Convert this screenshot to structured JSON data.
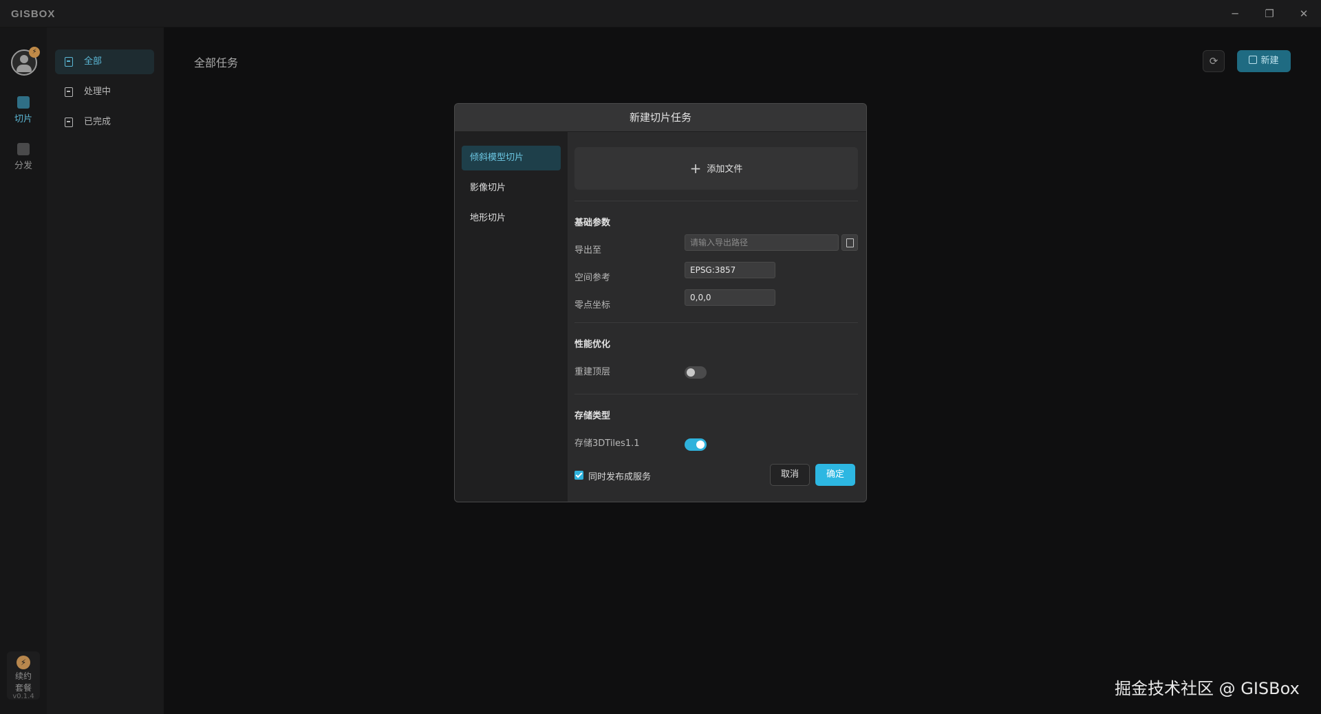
{
  "app": {
    "logo": "GISBOX"
  },
  "window_controls": {
    "minimize": "─",
    "restore": "❐",
    "close": "✕"
  },
  "rail": {
    "avatar_badge": "⚡",
    "items": [
      {
        "label": "切片",
        "icon": "slice-icon"
      },
      {
        "label": "分发",
        "icon": "distribute-icon"
      }
    ],
    "renew": {
      "icon": "⚡",
      "label": "续约套餐"
    },
    "version": "v0.1.4"
  },
  "filters": {
    "items": [
      {
        "label": "全部"
      },
      {
        "label": "处理中"
      },
      {
        "label": "已完成"
      }
    ]
  },
  "main": {
    "title": "全部任务",
    "refresh_icon": "⟳",
    "new_button": "新建"
  },
  "modal": {
    "title": "新建切片任务",
    "tabs": [
      {
        "label": "倾斜模型切片"
      },
      {
        "label": "影像切片"
      },
      {
        "label": "地形切片"
      }
    ],
    "add_file": {
      "icon": "+",
      "label": "添加文件"
    },
    "basic": {
      "title": "基础参数",
      "export_label": "导出至",
      "export_placeholder": "请输入导出路径",
      "export_value": "",
      "crs_label": "空间参考",
      "crs_value": "EPSG:3857",
      "origin_label": "零点坐标",
      "origin_value": "0,0,0"
    },
    "perf": {
      "title": "性能优化",
      "rebuild_top_label": "重建顶层",
      "rebuild_top": false
    },
    "storage": {
      "title": "存储类型",
      "tiles_label": "存储3DTiles1.1",
      "tiles": true
    },
    "publish": {
      "label": "同时发布成服务",
      "checked": true
    },
    "cancel_label": "取消",
    "ok_label": "确定"
  },
  "watermark": "掘金技术社区 @ GISBox",
  "colors": {
    "accent": "#2db7e2",
    "active_text": "#5cb8d6",
    "background": "#0f0f10",
    "modal": "#2b2b2c"
  }
}
